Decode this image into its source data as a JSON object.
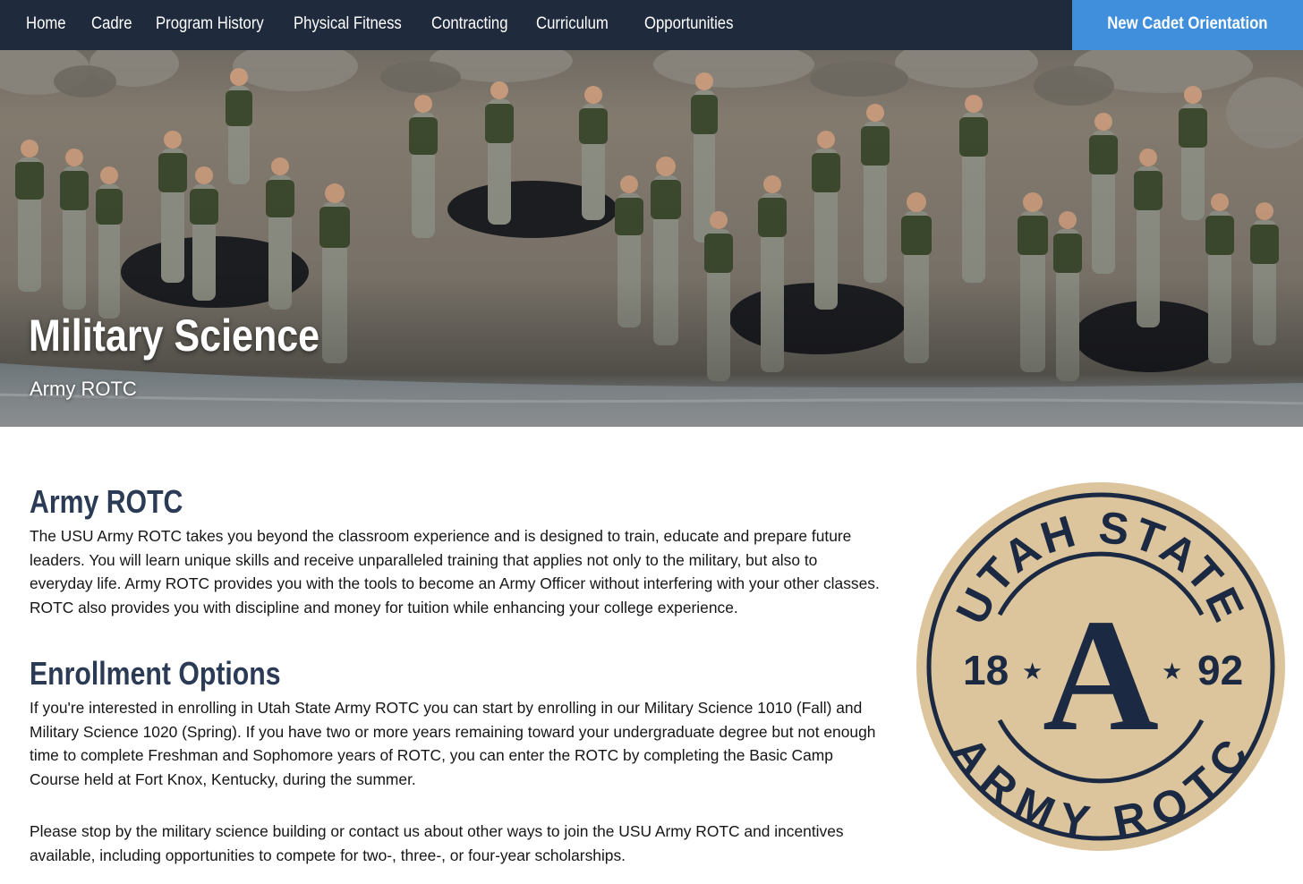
{
  "nav": {
    "items": [
      {
        "label": "Home",
        "name": "nav-home"
      },
      {
        "label": "Cadre",
        "name": "nav-cadre"
      },
      {
        "label": "Program History",
        "name": "nav-program-history"
      },
      {
        "label": "Physical Fitness",
        "name": "nav-physical-fitness"
      },
      {
        "label": "Contracting",
        "name": "nav-contracting"
      },
      {
        "label": "Curriculum",
        "name": "nav-curriculum"
      },
      {
        "label": "Opportunities",
        "name": "nav-opportunities"
      }
    ],
    "cta_label": "New Cadet Orientation"
  },
  "hero": {
    "title": "Military Science",
    "subtitle": "Army ROTC"
  },
  "main": {
    "section1": {
      "heading": "Army ROTC",
      "body": "The USU Army ROTC takes you beyond the classroom experience and is designed to train, educate and prepare future leaders. You will learn unique skills and receive unparalleled training that applies not only to the military, but also to everyday life. Army ROTC provides you with the tools to become an Army Officer without interfering with your other classes. ROTC also provides you with discipline and money for tuition while enhancing your college experience."
    },
    "section2": {
      "heading": "Enrollment Options",
      "body1": "If you're interested in enrolling in Utah State Army ROTC you can start by enrolling in our Military Science 1010 (Fall) and Military Science 1020 (Spring).  If you have two or more years remaining toward your undergraduate degree but not enough time to complete Freshman and Sophomore years of ROTC, you can enter the ROTC by completing the Basic Camp Course held at Fort Knox, Kentucky, during the summer.",
      "body2": "Please stop by the military science building or contact us about other ways to join the USU Army ROTC and incentives available, including opportunities to compete for two-, three-, or four-year scholarships."
    }
  },
  "seal": {
    "top_text": "UTAH STATE",
    "bottom_text": "ARMY ROTC",
    "letter": "A",
    "year_left": "18",
    "year_right": "92",
    "star": "★"
  },
  "colors": {
    "nav_bg": "#1f2a3d",
    "cta_bg": "#3f8fdc",
    "heading": "#2b3a55",
    "seal_gold": "#dcc49c",
    "seal_navy": "#1b2a42"
  }
}
